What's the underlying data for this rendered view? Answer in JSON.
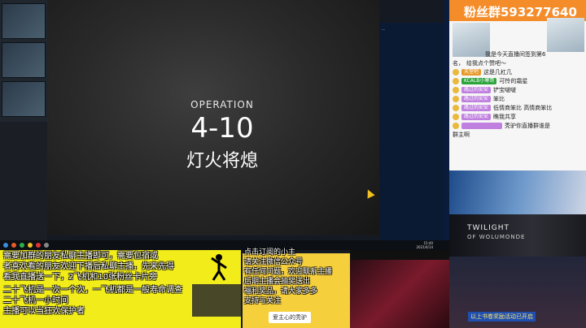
{
  "game": {
    "operation_label": "OPERATION",
    "operation_number": "4-10",
    "operation_name": "灯火将熄"
  },
  "fan_panel": {
    "title": "粉丝群593277640",
    "lines": [
      {
        "name": "",
        "text": "我是今天直播间签到第6"
      },
      {
        "name": "名，",
        "text": "给我点个赞吧～"
      },
      {
        "name": "天堂吧",
        "text": "这是几杠几"
      },
      {
        "name": "KCALB小寒哥",
        "text": "可怜的霜星"
      },
      {
        "name": "路过的安安",
        "text": "铲宝啵啵"
      },
      {
        "name": "路过的安安",
        "text": "笨比"
      },
      {
        "name": "路过的安安",
        "text": "低情商笨比 高情商笨比"
      },
      {
        "name": "路过的安安",
        "text": "瞧我共享"
      },
      {
        "name": "",
        "text": "秃驴你直播群谁是"
      },
      {
        "name": "",
        "text": "群主啊"
      }
    ]
  },
  "banners": {
    "twilight_title": "TWILIGHT",
    "twilight_sub": "OF WOLUMONDE",
    "bottom_text": "以上书卷奖励活动已开启"
  },
  "notice": {
    "lines": [
      "需要加群的朋友私聊主播即可，需要包宿或",
      "者喜欢看的朋友欢迎下播后私聊主播，先来先得",
      "看我直播送一下，2飞机和10张粉丝卡片旁",
      "二十飞机是一次一个次，一飞机都是一般寿命调查",
      "二十飞机一小时间",
      "主播可以当狂欢保护者"
    ]
  },
  "voice_card": {
    "lines": [
      "点击订阅的小主",
      "请关注微信公众号",
      "有任何问题，欢迎联系主播",
      "后期主播会抽奖送出",
      "福利奖品，请大家多多",
      "支持与关注"
    ],
    "signature": "爱主心的秃驴"
  },
  "taskbar": {
    "time": "15:40",
    "date": "2021/4/14"
  }
}
